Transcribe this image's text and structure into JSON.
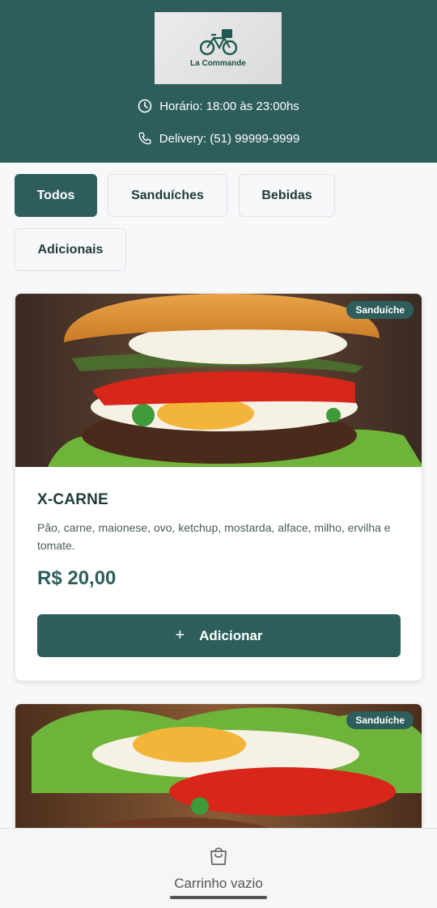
{
  "header": {
    "logo_text": "La Commande",
    "hours": "Horário: 18:00 às 23:00hs",
    "delivery": "Delivery: (51) 99999-9999",
    "bg_color": "#2d5e5b"
  },
  "filters": [
    {
      "label": "Todos",
      "active": true
    },
    {
      "label": "Sanduíches",
      "active": false
    },
    {
      "label": "Bebidas",
      "active": false
    },
    {
      "label": "Adicionais",
      "active": false
    }
  ],
  "products": [
    {
      "badge": "Sanduíche",
      "title": "X-CARNE",
      "description": "Pão, carne, maionese, ovo, ketchup, mostarda, alface, milho, ervilha e tomate.",
      "price": "R$ 20,00",
      "button_label": "Adicionar"
    },
    {
      "badge": "Sanduíche"
    }
  ],
  "cart": {
    "label": "Carrinho vazio",
    "icon": "shopping-bag-icon"
  },
  "icons": {
    "hours": "clock-icon",
    "delivery": "phone-icon",
    "logo": "bicycle-delivery-icon"
  }
}
